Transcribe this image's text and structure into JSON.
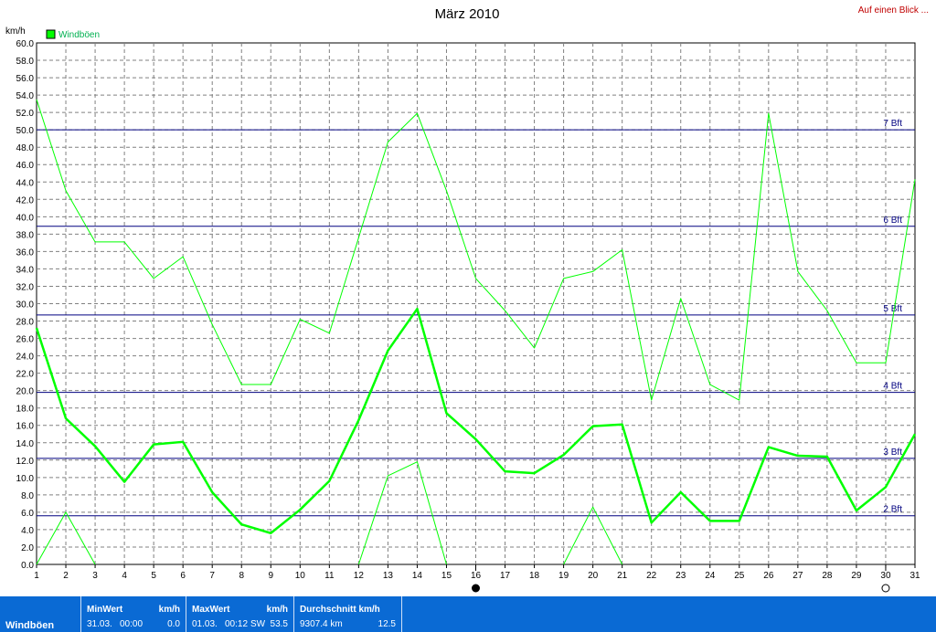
{
  "link": "Auf einen Blick ...",
  "chart_data": {
    "type": "line",
    "title": "März 2010",
    "ylabel": "km/h",
    "legend": "Windböen",
    "legend_position": "top-left",
    "grid": true,
    "ylim": [
      0,
      60
    ],
    "y_ticks": [
      "0.0",
      "2.0",
      "4.0",
      "6.0",
      "8.0",
      "10.0",
      "12.0",
      "14.0",
      "16.0",
      "18.0",
      "20.0",
      "22.0",
      "24.0",
      "26.0",
      "28.0",
      "30.0",
      "32.0",
      "34.0",
      "36.0",
      "38.0",
      "40.0",
      "42.0",
      "44.0",
      "46.0",
      "48.0",
      "50.0",
      "52.0",
      "54.0",
      "56.0",
      "58.0",
      "60.0"
    ],
    "x": [
      1,
      2,
      3,
      4,
      5,
      6,
      7,
      8,
      9,
      10,
      11,
      12,
      13,
      14,
      15,
      16,
      17,
      18,
      19,
      20,
      21,
      22,
      23,
      24,
      25,
      26,
      27,
      28,
      29,
      30,
      31
    ],
    "x_labels": [
      "1",
      "2",
      "3",
      "4",
      "5",
      "6",
      "7",
      "8",
      "9",
      "10",
      "11",
      "12",
      "13",
      "14",
      "15",
      "16",
      "17",
      "18",
      "19",
      "20",
      "21",
      "22",
      "23",
      "24",
      "25",
      "26",
      "27",
      "28",
      "29",
      "30",
      "31"
    ],
    "series": [
      {
        "name": "Windböen",
        "role": "avg",
        "color": "#00ff00",
        "values": [
          27.2,
          16.8,
          13.6,
          9.5,
          13.8,
          14.1,
          8.3,
          4.6,
          3.6,
          6.3,
          9.6,
          16.6,
          24.6,
          29.4,
          17.4,
          14.4,
          10.7,
          10.5,
          12.6,
          15.9,
          16.1,
          4.8,
          8.3,
          5.0,
          5.0,
          13.5,
          12.5,
          12.4,
          6.2,
          8.9,
          15.0
        ]
      },
      {
        "role": "max",
        "color": "#00ff00",
        "values": [
          53.5,
          43.0,
          37.1,
          37.1,
          32.9,
          35.4,
          27.6,
          20.7,
          20.7,
          28.2,
          26.6,
          37.6,
          48.6,
          51.9,
          43.0,
          32.9,
          29.2,
          24.9,
          32.9,
          33.7,
          36.2,
          18.9,
          30.6,
          20.7,
          18.9,
          51.9,
          33.7,
          29.2,
          23.2,
          23.2,
          44.3
        ]
      },
      {
        "role": "min",
        "color": "#00ff00",
        "values": [
          0.0,
          6.0,
          0.0,
          null,
          null,
          null,
          null,
          null,
          null,
          null,
          null,
          0.0,
          10.2,
          11.8,
          0.0,
          null,
          null,
          null,
          0.0,
          6.6,
          0.0,
          null,
          null,
          null,
          null,
          null,
          null,
          null,
          null,
          null,
          null
        ]
      }
    ],
    "reference_lines": [
      {
        "label": "2 Bft",
        "value": 5.6
      },
      {
        "label": "3 Bft",
        "value": 12.2
      },
      {
        "label": "4 Bft",
        "value": 19.8
      },
      {
        "label": "5 Bft",
        "value": 28.7
      },
      {
        "label": "6 Bft",
        "value": 38.9
      },
      {
        "label": "7 Bft",
        "value": 50.0
      }
    ],
    "markers": [
      {
        "x": 16,
        "type": "new-moon"
      },
      {
        "x": 30,
        "type": "full-moon"
      }
    ],
    "colors": {
      "series": "#00ff00",
      "reference": "#000080",
      "grid": "#808080"
    }
  },
  "footer": {
    "name": "Windböen",
    "min": {
      "header": "MinWert",
      "unit": "km/h",
      "date": "31.03.",
      "time": "00:00",
      "value": "0.0"
    },
    "max": {
      "header": "MaxWert",
      "unit": "km/h",
      "date": "01.03.",
      "time": "00:12",
      "dir": "SW",
      "value": "53.5"
    },
    "avg": {
      "header": "Durchschnitt km/h",
      "distance": "9307.4 km",
      "value": "12.5"
    }
  }
}
